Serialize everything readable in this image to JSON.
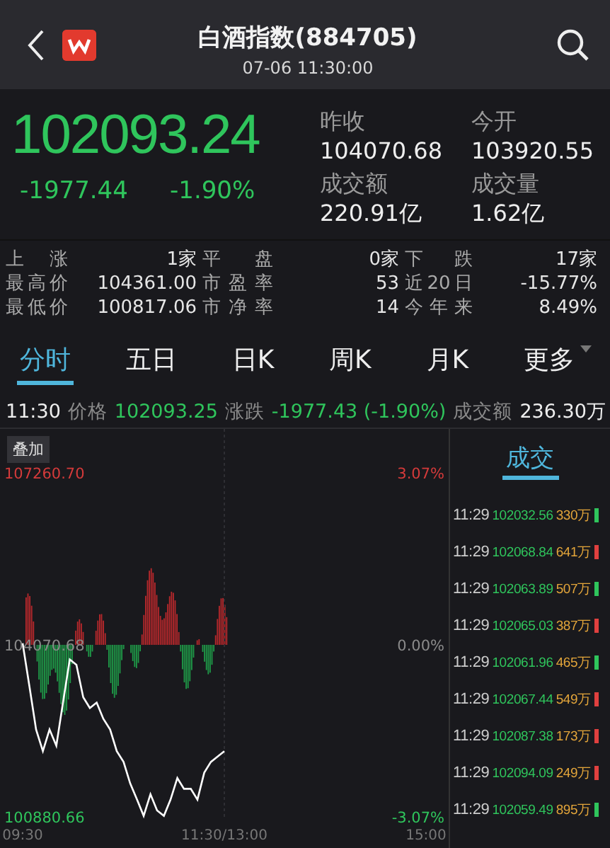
{
  "header": {
    "title": "白酒指数(884705)",
    "subtitle": "07-06 11:30:00"
  },
  "quote": {
    "price": "102093.24",
    "change": "-1977.44",
    "change_pct": "-1.90%",
    "fields": [
      {
        "label": "昨收",
        "value": "104070.68"
      },
      {
        "label": "今开",
        "value": "103920.55"
      },
      {
        "label": "成交额",
        "value": "220.91亿"
      },
      {
        "label": "成交量",
        "value": "1.62亿"
      }
    ]
  },
  "stats": {
    "rows": [
      [
        {
          "label": "上 涨",
          "value": "1家"
        },
        {
          "label": "平 盘",
          "value": "0家"
        },
        {
          "label": "下 跌",
          "value": "17家"
        }
      ],
      [
        {
          "label": "最高价",
          "value": "104361.00"
        },
        {
          "label": "市盈率",
          "value": "53"
        },
        {
          "label": "近20日",
          "value": "-15.77%"
        }
      ],
      [
        {
          "label": "最低价",
          "value": "100817.06"
        },
        {
          "label": "市净率",
          "value": "14"
        },
        {
          "label": "今年来",
          "value": "8.49%"
        }
      ]
    ]
  },
  "tabs": [
    {
      "label": "分时",
      "selected": true,
      "kind": "tab"
    },
    {
      "label": "五日",
      "selected": false,
      "kind": "tab"
    },
    {
      "label": "日K",
      "selected": false,
      "kind": "tab"
    },
    {
      "label": "周K",
      "selected": false,
      "kind": "tab"
    },
    {
      "label": "月K",
      "selected": false,
      "kind": "tab"
    },
    {
      "label": "更多",
      "selected": false,
      "kind": "menu"
    }
  ],
  "info_line": {
    "time": "11:30",
    "price_label": "价格",
    "price": "102093.25",
    "change_label": "涨跌",
    "change": "-1977.43 (-1.90%)",
    "amount_label": "成交额",
    "amount": "236.30万"
  },
  "chart": {
    "overlay_button": "叠加",
    "right_axis_labels": [
      "3.07%",
      "0.00%",
      "-3.07%"
    ],
    "chart_data": {
      "type": "line",
      "categories": [
        "09:30",
        null,
        null,
        null,
        null,
        null,
        null,
        null,
        null,
        null,
        null,
        null,
        null,
        null,
        null,
        null,
        null,
        null,
        null,
        null,
        null,
        null,
        null,
        null,
        null,
        null,
        null,
        null,
        null,
        null,
        "11:30/13:00",
        null,
        null,
        null,
        null,
        null,
        null,
        null,
        null,
        null,
        null,
        null,
        null,
        null,
        null,
        null,
        null,
        null,
        null,
        null,
        null,
        null,
        null,
        null,
        null,
        null,
        null,
        null,
        null,
        null,
        "15:00"
      ],
      "series": [
        {
          "color": "#ffffff",
          "values": [
            104100,
            103300,
            102500,
            102100,
            102500,
            102200,
            103000,
            103800,
            103700,
            103100,
            102900,
            103000,
            102700,
            102500,
            102100,
            101900,
            101500,
            101200,
            100900,
            101300,
            101000,
            100900,
            101200,
            101600,
            101400,
            101400,
            101200,
            101700,
            101900,
            102000,
            102100,
            null,
            null,
            null,
            null,
            null,
            null,
            null,
            null,
            null,
            null,
            null,
            null,
            null,
            null,
            null,
            null,
            null,
            null,
            null,
            null,
            null,
            null,
            null,
            null,
            null,
            null,
            null,
            null,
            null,
            null
          ]
        }
      ],
      "ylim": [
        100880.66,
        107260.7
      ],
      "yticks": [
        {
          "value": 107260.7,
          "label": "107260.70"
        },
        {
          "value": 104070.68,
          "label": "104070.68"
        },
        {
          "value": 100880.66,
          "label": "100880.66"
        }
      ]
    }
  },
  "trades": {
    "title": "成交",
    "rows": [
      {
        "time": "11:29",
        "price": "102032.56",
        "volume": "330万",
        "color": "#2fc55c"
      },
      {
        "time": "11:29",
        "price": "102068.84",
        "volume": "641万",
        "color": "#e0403f"
      },
      {
        "time": "11:29",
        "price": "102063.89",
        "volume": "507万",
        "color": "#2fc55c"
      },
      {
        "time": "11:29",
        "price": "102065.03",
        "volume": "387万",
        "color": "#e0403f"
      },
      {
        "time": "11:29",
        "price": "102061.96",
        "volume": "465万",
        "color": "#2fc55c"
      },
      {
        "time": "11:29",
        "price": "102067.44",
        "volume": "549万",
        "color": "#e0403f"
      },
      {
        "time": "11:29",
        "price": "102087.38",
        "volume": "173万",
        "color": "#e0403f"
      },
      {
        "time": "11:29",
        "price": "102094.09",
        "volume": "249万",
        "color": "#e0403f"
      },
      {
        "time": "11:29",
        "price": "102059.49",
        "volume": "895万",
        "color": "#2fc55c"
      }
    ]
  }
}
